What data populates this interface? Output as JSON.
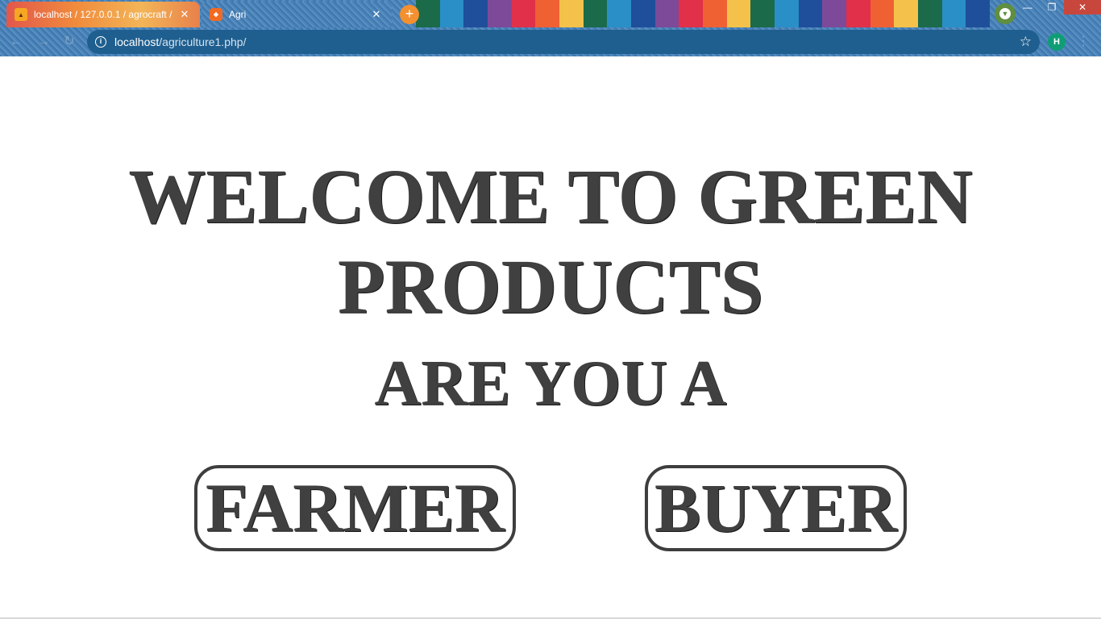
{
  "browser": {
    "tabs": [
      {
        "title": "localhost / 127.0.0.1 / agrocraft /",
        "favicon": "phpmyadmin-icon",
        "active": true
      },
      {
        "title": "Agri",
        "favicon": "xampp-icon",
        "active": false
      }
    ],
    "new_tab_label": "+",
    "address": {
      "host": "localhost",
      "path": "/agriculture1.php/"
    },
    "profile_initial": "H",
    "stripe_colors": [
      "#1b6b4a",
      "#2a8fc7",
      "#1f4f9a",
      "#7d4a9a",
      "#e0304a",
      "#ef6033",
      "#f4c24a"
    ]
  },
  "page": {
    "welcome_heading": "WELCOME TO GREEN PRODUCTS",
    "question": "ARE YOU A",
    "farmer_button": "FARMER",
    "buyer_button": "BUYER"
  },
  "colors": {
    "text": "#404040",
    "button_border": "#3e3e3e",
    "background": "#ffffff"
  }
}
